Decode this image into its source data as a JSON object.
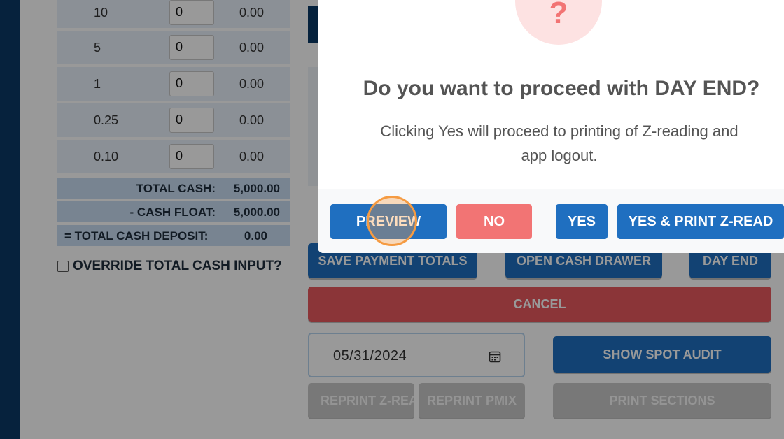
{
  "denominations": [
    {
      "label": "10",
      "count": "0",
      "amount": "0.00"
    },
    {
      "label": "5",
      "count": "0",
      "amount": "0.00"
    },
    {
      "label": "1",
      "count": "0",
      "amount": "0.00"
    },
    {
      "label": "0.25",
      "count": "0",
      "amount": "0.00"
    },
    {
      "label": "0.10",
      "count": "0",
      "amount": "0.00"
    }
  ],
  "summary": {
    "total_cash_label": "TOTAL CASH:",
    "total_cash_value": "5,000.00",
    "cash_float_label": "- CASH FLOAT:",
    "cash_float_value": "5,000.00",
    "deposit_label": "= TOTAL CASH DEPOSIT:",
    "deposit_value": "0.00"
  },
  "override_label": "OVERRIDE TOTAL CASH INPUT?",
  "actions": {
    "save_payment_totals": "SAVE PAYMENT TOTALS",
    "open_cash_drawer": "OPEN CASH DRAWER",
    "day_end": "DAY END",
    "cancel": "CANCEL",
    "show_spot_audit": "SHOW SPOT AUDIT",
    "reprint_zread": "REPRINT Z-REA",
    "reprint_pmix": "REPRINT PMIX",
    "print_sections": "PRINT SECTIONS"
  },
  "date_value": "05/31/2024",
  "dialog": {
    "icon": "?",
    "title": "Do you want to proceed with DAY END?",
    "message": "Clicking Yes will proceed to printing of Z-reading and app logout.",
    "preview": "PREVIEW",
    "no": "NO",
    "yes": "YES",
    "yes_print": "YES & PRINT Z-READ"
  },
  "colors": {
    "primary": "#1f6fc0",
    "danger": "#e8595e",
    "dialog_no": "#f27474",
    "sidebar": "#0b3a66"
  }
}
